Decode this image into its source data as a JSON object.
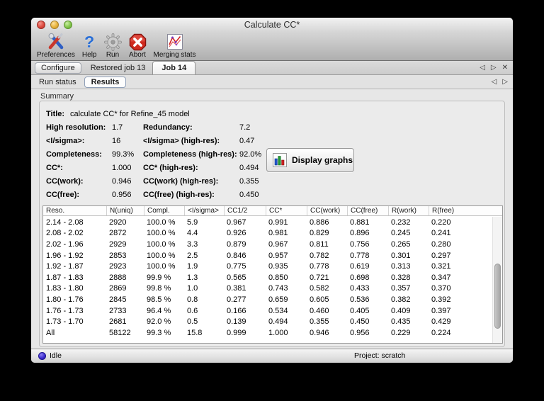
{
  "window": {
    "title": "Calculate CC*"
  },
  "toolbar": {
    "items": [
      {
        "label": "Preferences",
        "icon": "preferences-tools-icon"
      },
      {
        "label": "Help",
        "icon": "help-question-icon",
        "glyph": "?"
      },
      {
        "label": "Run",
        "icon": "run-gear-icon"
      },
      {
        "label": "Abort",
        "icon": "abort-stop-icon"
      },
      {
        "label": "Merging stats",
        "icon": "merging-stats-chart-icon"
      }
    ]
  },
  "tabs": {
    "items": [
      {
        "label": "Configure",
        "state": "outlined"
      },
      {
        "label": "Restored job 13",
        "state": "plain"
      },
      {
        "label": "Job 14",
        "state": "selected"
      }
    ]
  },
  "subtabs": {
    "items": [
      {
        "label": "Run status",
        "state": "plain"
      },
      {
        "label": "Results",
        "state": "selected"
      }
    ]
  },
  "icons": {
    "tab_prev": "◁",
    "tab_next": "▷",
    "tab_close": "✕"
  },
  "summary": {
    "group_label": "Summary",
    "title_label": "Title:",
    "title_value": "calculate CC* for Refine_45 model",
    "rows": [
      {
        "label1": "High resolution:",
        "value1": "1.7",
        "label2": "Redundancy:",
        "value2": "7.2"
      },
      {
        "label1": "<I/sigma>:",
        "value1": "16",
        "label2": "<I/sigma> (high-res):",
        "value2": "0.47"
      },
      {
        "label1": "Completeness:",
        "value1": "99.3%",
        "label2": "Completeness (high-res):",
        "value2": "92.0%"
      },
      {
        "label1": "CC*:",
        "value1": "1.000",
        "label2": "CC* (high-res):",
        "value2": "0.494"
      },
      {
        "label1": "CC(work):",
        "value1": "0.946",
        "label2": "CC(work) (high-res):",
        "value2": "0.355"
      },
      {
        "label1": "CC(free):",
        "value1": "0.956",
        "label2": "CC(free) (high-res):",
        "value2": "0.450"
      }
    ],
    "display_graphs_label": "Display graphs"
  },
  "table": {
    "columns": [
      "Reso.",
      "N(uniq)",
      "Compl.",
      "<I/sigma>",
      "CC1/2",
      "CC*",
      "CC(work)",
      "CC(free)",
      "R(work)",
      "R(free)"
    ],
    "rows": [
      [
        "2.14 - 2.08",
        "2920",
        "100.0 %",
        "5.9",
        "0.967",
        "0.991",
        "0.886",
        "0.881",
        "0.232",
        "0.220"
      ],
      [
        "2.08 - 2.02",
        "2872",
        "100.0 %",
        "4.4",
        "0.926",
        "0.981",
        "0.829",
        "0.896",
        "0.245",
        "0.241"
      ],
      [
        "2.02 - 1.96",
        "2929",
        "100.0 %",
        "3.3",
        "0.879",
        "0.967",
        "0.811",
        "0.756",
        "0.265",
        "0.280"
      ],
      [
        "1.96 - 1.92",
        "2853",
        "100.0 %",
        "2.5",
        "0.846",
        "0.957",
        "0.782",
        "0.778",
        "0.301",
        "0.297"
      ],
      [
        "1.92 - 1.87",
        "2923",
        "100.0 %",
        "1.9",
        "0.775",
        "0.935",
        "0.778",
        "0.619",
        "0.313",
        "0.321"
      ],
      [
        "1.87 - 1.83",
        "2888",
        "99.9 %",
        "1.3",
        "0.565",
        "0.850",
        "0.721",
        "0.698",
        "0.328",
        "0.347"
      ],
      [
        "1.83 - 1.80",
        "2869",
        "99.8 %",
        "1.0",
        "0.381",
        "0.743",
        "0.582",
        "0.433",
        "0.357",
        "0.370"
      ],
      [
        "1.80 - 1.76",
        "2845",
        "98.5 %",
        "0.8",
        "0.277",
        "0.659",
        "0.605",
        "0.536",
        "0.382",
        "0.392"
      ],
      [
        "1.76 - 1.73",
        "2733",
        "96.4 %",
        "0.6",
        "0.166",
        "0.534",
        "0.460",
        "0.405",
        "0.409",
        "0.397"
      ],
      [
        "1.73 - 1.70",
        "2681",
        "92.0 %",
        "0.5",
        "0.139",
        "0.494",
        "0.355",
        "0.450",
        "0.435",
        "0.429"
      ],
      [
        "All",
        "58122",
        "99.3 %",
        "15.8",
        "0.999",
        "1.000",
        "0.946",
        "0.956",
        "0.229",
        "0.224"
      ]
    ]
  },
  "statusbar": {
    "status": "Idle",
    "project": "Project: scratch"
  },
  "colors": {
    "help_blue": "#2a6fd6",
    "abort_red": "#cc2020",
    "status_dot_blue": "#3e2fd0",
    "graph_bar_blue": "#2255cc",
    "graph_bar_green": "#229933",
    "graph_bar_red": "#cc2222"
  }
}
